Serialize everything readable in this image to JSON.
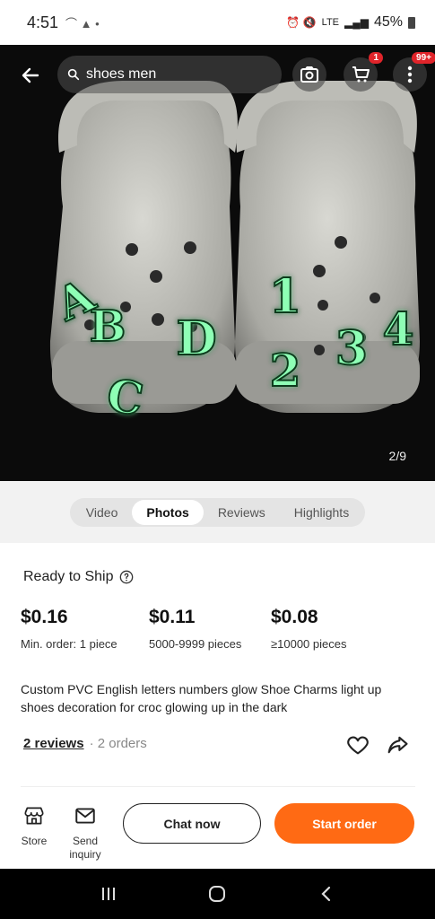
{
  "status": {
    "time": "4:51",
    "battery": "45%",
    "network": "LTE"
  },
  "search": {
    "query": "shoes men"
  },
  "header": {
    "cart_badge": "1",
    "menu_badge": "99+"
  },
  "gallery": {
    "counter": "2/9",
    "charm_letters": [
      "A",
      "B",
      "C",
      "D"
    ],
    "charm_numbers": [
      "1",
      "2",
      "3",
      "4"
    ]
  },
  "tabs": [
    {
      "label": "Video"
    },
    {
      "label": "Photos"
    },
    {
      "label": "Reviews"
    },
    {
      "label": "Highlights"
    }
  ],
  "product": {
    "ready_label": "Ready to Ship",
    "prices": [
      {
        "price": "$0.16",
        "qty": "Min. order: 1 piece"
      },
      {
        "price": "$0.11",
        "qty": "5000-9999 pieces"
      },
      {
        "price": "$0.08",
        "qty": "≥10000 pieces"
      }
    ],
    "description": "Custom PVC English letters numbers glow Shoe Charms light up shoes decoration for croc glowing up in the dark",
    "reviews": "2 reviews",
    "orders": "· 2 orders"
  },
  "bottom": {
    "store": "Store",
    "inquiry": "Send inquiry",
    "chat": "Chat now",
    "order": "Start order"
  },
  "colors": {
    "accent": "#ff6a14",
    "badge": "#e0242a",
    "glow": "#7dffae"
  }
}
